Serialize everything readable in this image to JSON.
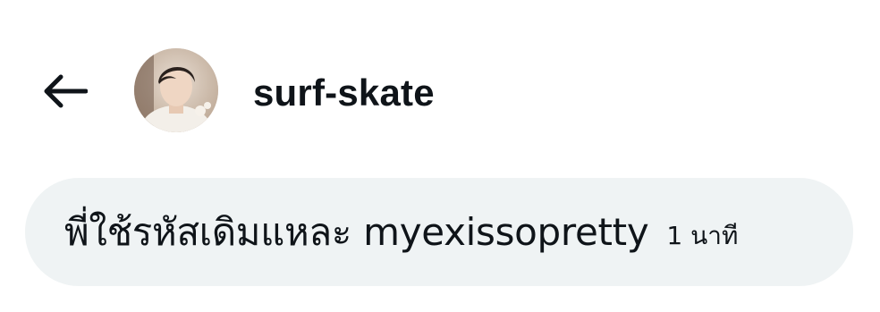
{
  "header": {
    "back_icon": "arrow-left-icon",
    "username": "surf-skate",
    "avatar_icon": "user-avatar"
  },
  "message": {
    "text": "พี่ใช้รหัสเดิมแหละ myexissopretty",
    "time": "1 นาที"
  },
  "colors": {
    "bubble_background": "#eff3f4",
    "text": "#0f1419",
    "page_background": "#ffffff"
  }
}
